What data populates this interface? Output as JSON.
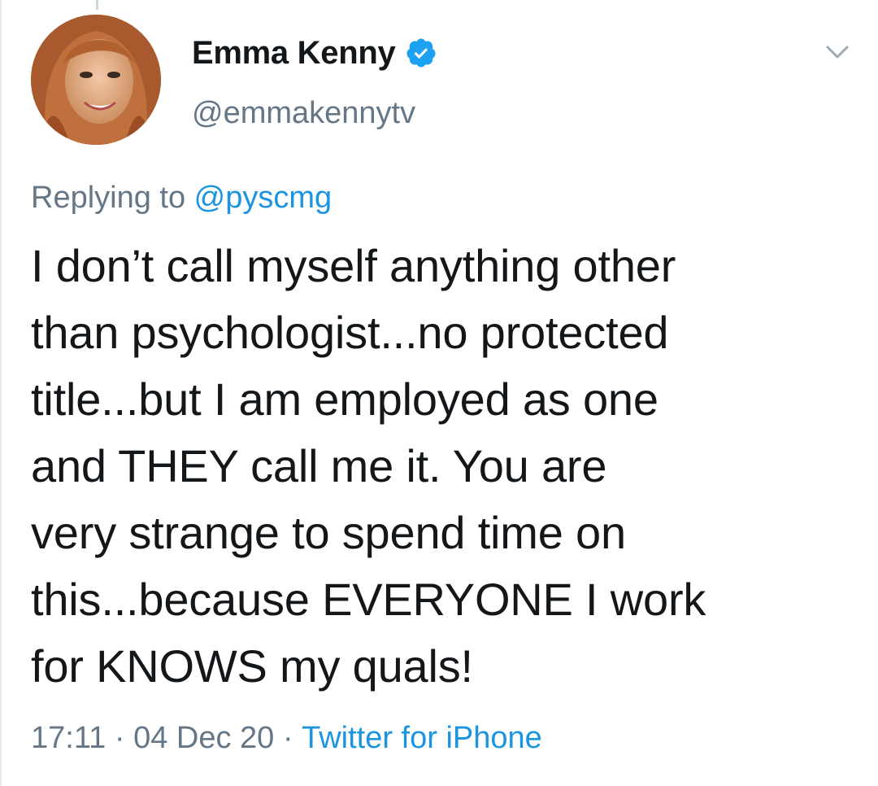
{
  "tweet": {
    "author": {
      "display_name": "Emma Kenny",
      "handle": "@emmakennytv",
      "verified": true,
      "avatar_icon": "profile-photo"
    },
    "reply": {
      "prefix": "Replying to ",
      "mention": "@pyscmg"
    },
    "text": "I don’t call myself anything other\nthan psychologist...no protected\ntitle...but I am employed as one\nand THEY call me it. You are\nvery strange to spend time on\nthis...because EVERYONE I work\nfor KNOWS my quals!",
    "time": "17:11",
    "date": "04 Dec 20",
    "separator": " · ",
    "source": "Twitter for iPhone"
  },
  "colors": {
    "text": "#14171a",
    "secondary": "#657786",
    "link": "#1b95e0",
    "verified": "#1da1f2"
  }
}
